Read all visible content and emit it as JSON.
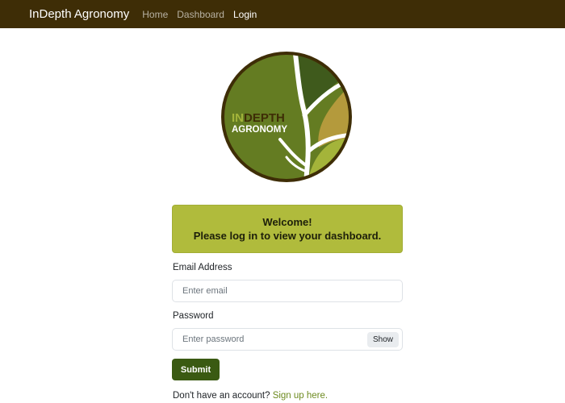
{
  "navbar": {
    "brand": "InDepth Agronomy",
    "links": [
      "Home",
      "Dashboard",
      "Login"
    ]
  },
  "logo": {
    "text_line1_prefix": "IN",
    "text_line1_rest": "DEPTH",
    "text_line2": "AGRONOMY",
    "colors": {
      "ring": "#3e2d06",
      "left_fill": "#647c22",
      "dark_leaf": "#3f5a1c",
      "tan_leaf": "#b49a3c",
      "lime_leaf": "#a4b43a",
      "in_accent": "#a4b43a"
    }
  },
  "welcome": {
    "line1": "Welcome!",
    "line2": "Please log in to view your dashboard."
  },
  "form": {
    "email_label": "Email Address",
    "email_placeholder": "Enter email",
    "password_label": "Password",
    "password_placeholder": "Enter password",
    "show_label": "Show",
    "submit_label": "Submit"
  },
  "signup": {
    "prompt": "Don't have an account?",
    "link": "Sign up here."
  },
  "colors": {
    "navbar_bg": "#3e2d06",
    "alert_bg": "#b0bb3c",
    "submit_bg": "#3a5a12",
    "link": "#6d8a1f"
  }
}
